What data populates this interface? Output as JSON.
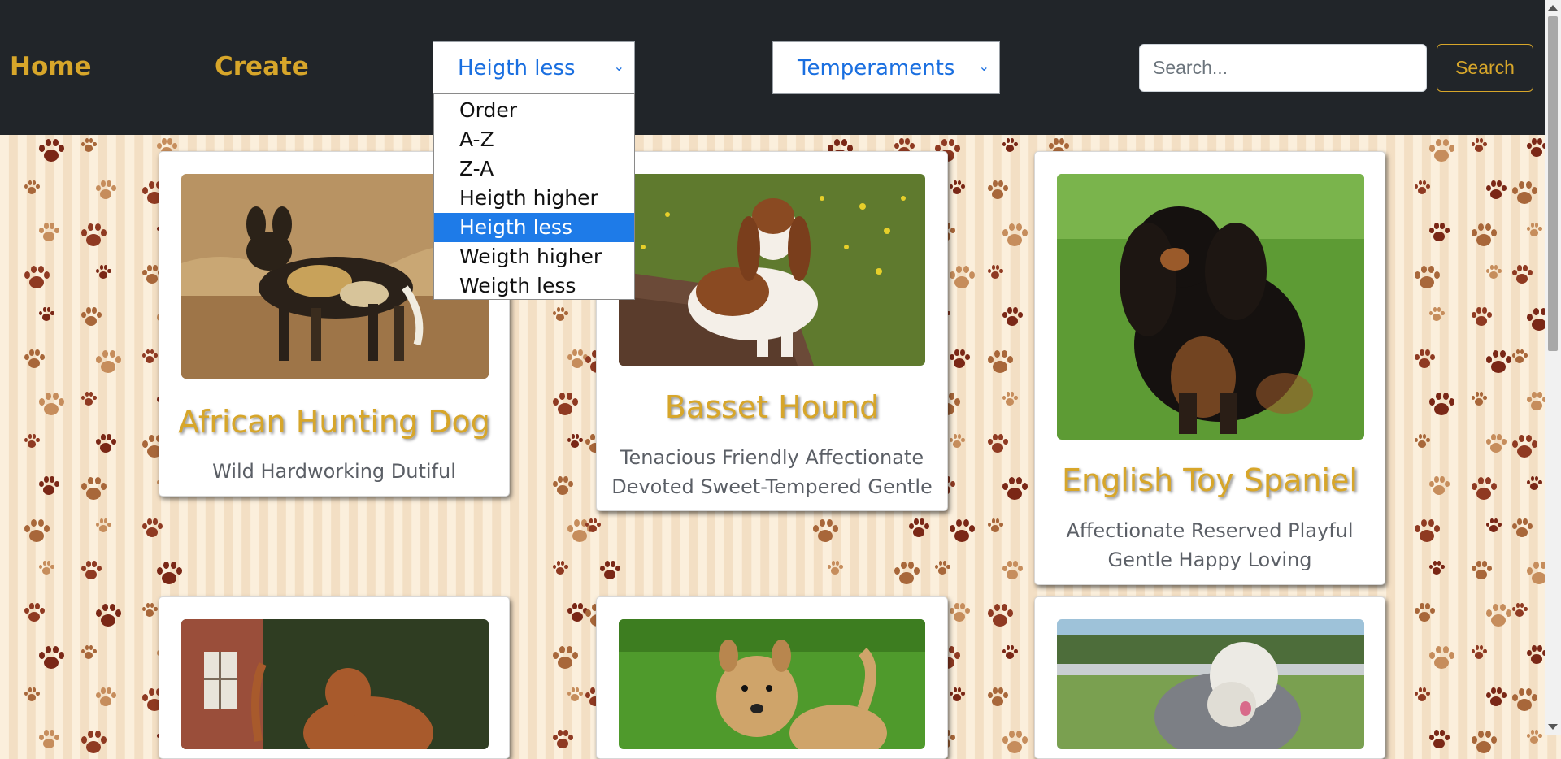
{
  "nav": {
    "home_label": "Home",
    "create_label": "Create",
    "order_select": {
      "selected": "Heigth less",
      "options": [
        "Order",
        "A-Z",
        "Z-A",
        "Heigth higher",
        "Heigth less",
        "Weigth higher",
        "Weigth less"
      ]
    },
    "temperaments_select": {
      "selected": "Temperaments"
    },
    "search": {
      "placeholder": "Search...",
      "value": ""
    },
    "search_button_label": "Search"
  },
  "cards": [
    {
      "name": "African Hunting Dog",
      "temperaments": [
        "Wild Hardworking Dutiful"
      ]
    },
    {
      "name": "Basset Hound",
      "temperaments": [
        "Tenacious Friendly Affectionate",
        "Devoted Sweet-Tempered Gentle"
      ]
    },
    {
      "name": "English Toy Spaniel",
      "temperaments": [
        "Affectionate Reserved Playful",
        "Gentle Happy Loving"
      ]
    },
    {
      "name": "",
      "temperaments": []
    },
    {
      "name": "",
      "temperaments": []
    },
    {
      "name": "",
      "temperaments": []
    }
  ],
  "colors": {
    "navbar": "#212529",
    "accent": "#d7a62a",
    "select_text": "#1a6fe0",
    "dropdown_highlight": "#1e7be8",
    "temperament_text": "#5b5f66"
  },
  "icons": {
    "select_chevron": "chevron-down-icon",
    "background_pattern": "paw-print-icon"
  }
}
